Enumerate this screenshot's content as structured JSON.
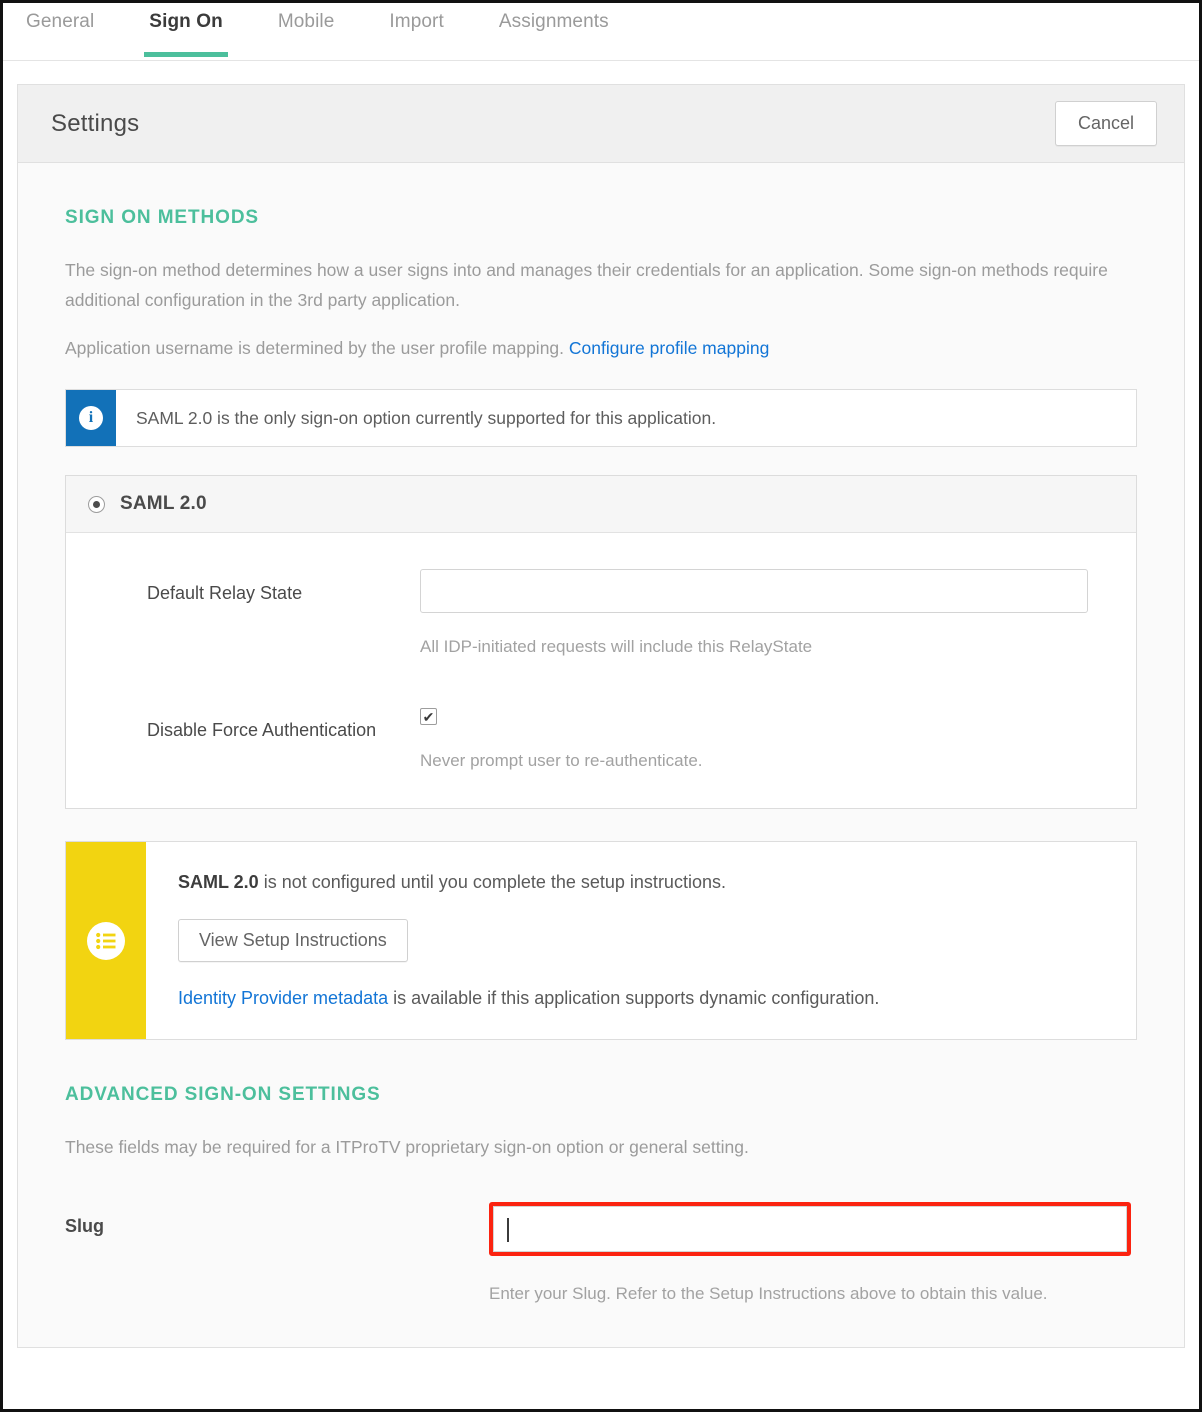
{
  "tabs": [
    {
      "label": "General",
      "active": false
    },
    {
      "label": "Sign On",
      "active": true
    },
    {
      "label": "Mobile",
      "active": false
    },
    {
      "label": "Import",
      "active": false
    },
    {
      "label": "Assignments",
      "active": false
    }
  ],
  "card": {
    "title": "Settings",
    "cancel_label": "Cancel"
  },
  "sign_on_methods": {
    "heading": "SIGN ON METHODS",
    "description": "The sign-on method determines how a user signs into and manages their credentials for an application. Some sign-on methods require additional configuration in the 3rd party application.",
    "username_note": "Application username is determined by the user profile mapping.",
    "profile_mapping_link": "Configure profile mapping",
    "info_banner": {
      "icon": "info-circle-icon",
      "text": "SAML 2.0 is the only sign-on option currently supported for this application.",
      "bg_color": "#1271b8"
    }
  },
  "saml_panel": {
    "radio_label": "SAML 2.0",
    "radio_selected": true,
    "fields": [
      {
        "label": "Default Relay State",
        "type": "text",
        "value": "",
        "placeholder": "",
        "hint": "All IDP-initiated requests will include this RelayState"
      },
      {
        "label": "Disable Force Authentication",
        "type": "checkbox",
        "checked": true,
        "check_glyph": "✔",
        "hint": "Never prompt user to re-authenticate."
      }
    ]
  },
  "setup_banner": {
    "icon": "checklist-icon",
    "bg_color": "#f2d411",
    "bold_prefix": "SAML 2.0",
    "message": " is not configured until you complete the setup instructions.",
    "button_label": "View Setup Instructions",
    "metadata_link": "Identity Provider metadata",
    "metadata_text": " is available if this application supports dynamic configuration."
  },
  "advanced": {
    "heading": "ADVANCED SIGN-ON SETTINGS",
    "description": "These fields may be required for a ITProTV proprietary sign-on option or general setting.",
    "slug": {
      "label": "Slug",
      "value": "",
      "placeholder": "",
      "hint": "Enter your Slug. Refer to the Setup Instructions above to obtain this value.",
      "highlight_color": "#fb2310",
      "focused": true
    }
  },
  "theme": {
    "accent_green": "#4cbf9c",
    "link_blue": "#1275d6",
    "info_blue": "#1271b8",
    "warn_yellow": "#f2d411",
    "highlight_red": "#fb2310"
  }
}
